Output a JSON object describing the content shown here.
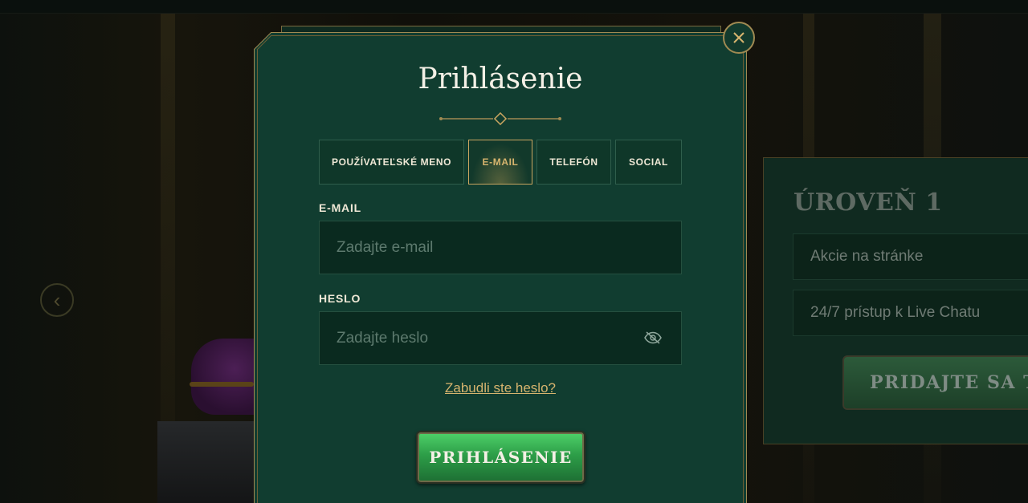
{
  "modal": {
    "title": "Prihlásenie",
    "tabs": [
      {
        "label": "POUŽÍVATEĽSKÉ MENO",
        "active": false
      },
      {
        "label": "E-MAIL",
        "active": true
      },
      {
        "label": "TELEFÓN",
        "active": false
      },
      {
        "label": "SOCIAL",
        "active": false
      }
    ],
    "email": {
      "label": "E-MAIL",
      "placeholder": "Zadajte e-mail",
      "value": ""
    },
    "password": {
      "label": "HESLO",
      "placeholder": "Zadajte heslo",
      "value": ""
    },
    "forgot_link": "Zabudli ste heslo?",
    "submit_label": "PRIHLÁSENIE",
    "close_icon": "close-icon",
    "password_toggle_icon": "eye-slash-icon"
  },
  "background_card": {
    "title": "ÚROVEŇ 1",
    "items": [
      "Akcie na stránke",
      "24/7 prístup k Live Chatu"
    ],
    "join_label": "PRIDAJTE SA TE"
  },
  "colors": {
    "modal_bg": "#113d30",
    "gold_accent": "#d6b46e",
    "button_green": "#2d9e48"
  }
}
